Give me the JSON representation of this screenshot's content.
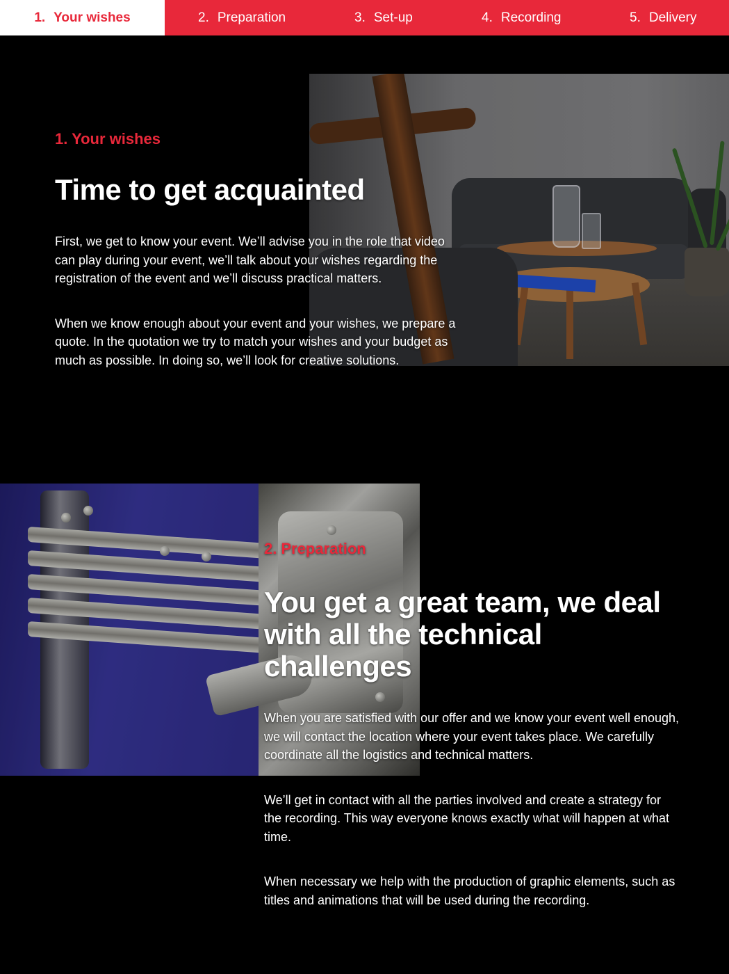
{
  "stepnav": {
    "steps": [
      {
        "num": "1.",
        "label": "Your wishes",
        "active": true
      },
      {
        "num": "2.",
        "label": "Preparation",
        "active": false
      },
      {
        "num": "3.",
        "label": "Set-up",
        "active": false
      },
      {
        "num": "4.",
        "label": "Recording",
        "active": false
      },
      {
        "num": "5.",
        "label": "Delivery",
        "active": false
      }
    ]
  },
  "sections": [
    {
      "kicker": "1. Your wishes",
      "headline": "Time to get acquainted",
      "paragraphs": [
        "First, we get to know your event. We’ll advise you in the role that video can play during your event, we’ll talk about your wishes regarding the registration of the event and we’ll discuss practical matters.",
        "When we know enough about your event and your wishes, we prepare a quote. In the quotation we try to match your wishes and your budget as much as possible. In doing so, we’ll look for creative solutions."
      ]
    },
    {
      "kicker": "2. Preparation",
      "headline": "You get a great team, we deal with all the technical challenges",
      "paragraphs": [
        "When you are satisfied with our offer and we know your event well enough, we will contact the location where your event takes place. We carefully coordinate all the logistics and technical matters.",
        "We’ll get in contact with all the parties involved and create a strategy for the recording. This way everyone knows exactly what will happen at what time.",
        "When necessary we help with the production of graphic elements, such as titles and animations that will be used during the recording."
      ]
    }
  ],
  "theme": {
    "accent": "#e8283a",
    "background": "#000000",
    "text": "#ffffff"
  }
}
